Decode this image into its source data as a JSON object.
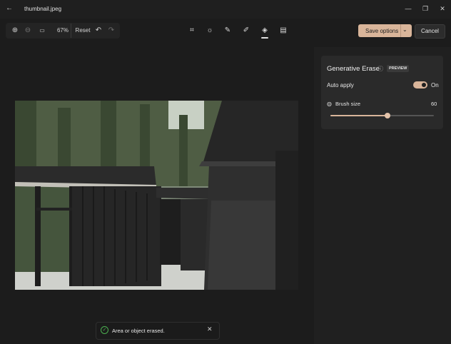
{
  "window": {
    "title": "thumbnail.jpeg",
    "back_icon": "back-arrow-icon",
    "controls": [
      "minimize-icon",
      "maximize-icon",
      "close-icon"
    ]
  },
  "toolbar": {
    "zoom_level": "67%",
    "reset_label": "Reset",
    "tools": [
      "crop-icon",
      "adjust-icon",
      "markup-icon",
      "draw-icon",
      "erase-icon",
      "filter-icon"
    ],
    "active_tool": "erase-icon",
    "save_label": "Save options",
    "cancel_label": "Cancel"
  },
  "panel": {
    "title": "Generative Erase",
    "badge": "PREVIEW",
    "auto_apply_label": "Auto apply",
    "auto_apply_state": "On",
    "brush_size_label": "Brush size",
    "brush_size_value": "60",
    "brush_size_fraction": 0.55
  },
  "toast": {
    "message": "Area or object erased."
  },
  "colors": {
    "accent": "#d9b59a",
    "background": "#1c1c1c",
    "panel": "#2a2a2a"
  }
}
